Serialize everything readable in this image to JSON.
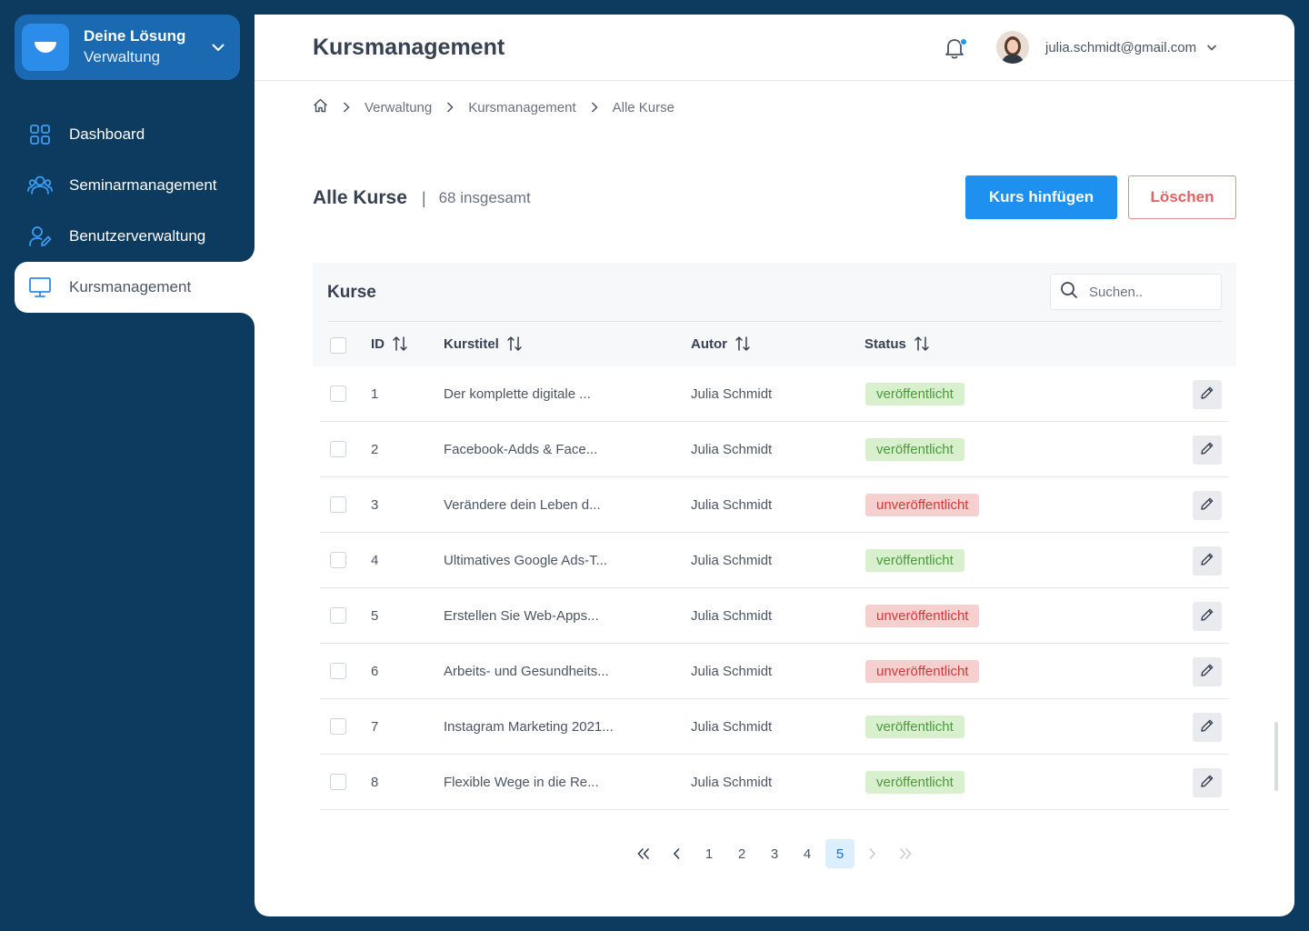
{
  "brand": {
    "name": "Deine Lösung",
    "subtitle": "Verwaltung"
  },
  "nav": [
    {
      "label": "Dashboard",
      "icon": "grid-icon"
    },
    {
      "label": "Seminarmanagement",
      "icon": "users-icon"
    },
    {
      "label": "Benutzerverwaltung",
      "icon": "user-edit-icon"
    },
    {
      "label": "Kursmanagement",
      "icon": "monitor-icon",
      "active": true
    }
  ],
  "header": {
    "title": "Kursmanagement",
    "user_email": "julia.schmidt@gmail.com",
    "notification_dot": true
  },
  "breadcrumb": {
    "items": [
      "Verwaltung",
      "Kursmanagement",
      "Alle Kurse"
    ]
  },
  "section": {
    "title": "Alle Kurse",
    "divider": "|",
    "count": "68 insgesamt"
  },
  "actions": {
    "add_label": "Kurs hinfügen",
    "delete_label": "Löschen"
  },
  "table": {
    "title": "Kurse",
    "search_placeholder": "Suchen..",
    "columns": {
      "id": "ID",
      "title": "Kurstitel",
      "author": "Autor",
      "status": "Status"
    },
    "rows": [
      {
        "id": "1",
        "title": "Der komplette digitale ...",
        "author": "Julia Schmidt",
        "status": "veröffentlicht",
        "published": true
      },
      {
        "id": "2",
        "title": "Facebook-Adds & Face...",
        "author": "Julia Schmidt",
        "status": "veröffentlicht",
        "published": true
      },
      {
        "id": "3",
        "title": "Verändere dein Leben d...",
        "author": "Julia Schmidt",
        "status": "unveröffentlicht",
        "published": false
      },
      {
        "id": "4",
        "title": "Ultimatives Google Ads-T...",
        "author": "Julia Schmidt",
        "status": "veröffentlicht",
        "published": true
      },
      {
        "id": "5",
        "title": "Erstellen Sie Web-Apps...",
        "author": "Julia Schmidt",
        "status": "unveröffentlicht",
        "published": false
      },
      {
        "id": "6",
        "title": "Arbeits- und Gesundheits...",
        "author": "Julia Schmidt",
        "status": "unveröffentlicht",
        "published": false
      },
      {
        "id": "7",
        "title": "Instagram Marketing 2021...",
        "author": "Julia Schmidt",
        "status": "veröffentlicht",
        "published": true
      },
      {
        "id": "8",
        "title": "Flexible Wege in die Re...",
        "author": "Julia Schmidt",
        "status": "veröffentlicht",
        "published": true
      }
    ]
  },
  "pagination": {
    "pages": [
      "1",
      "2",
      "3",
      "4",
      "5"
    ],
    "current": "5"
  },
  "colors": {
    "sidebar_bg": "#0d3a5f",
    "brand_bg": "#1b69b1",
    "accent": "#1e90f0",
    "danger": "#e06464",
    "published_bg": "#d9f0cf",
    "unpublished_bg": "#f6cfcf"
  }
}
